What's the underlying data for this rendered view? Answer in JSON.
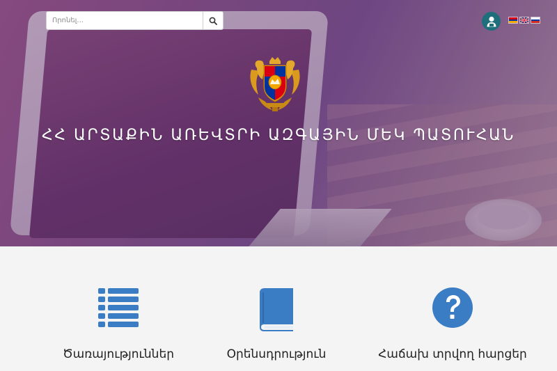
{
  "search": {
    "placeholder": "Որոնել..."
  },
  "header": {
    "user_icon": "user-icon",
    "languages": [
      {
        "code": "am",
        "colors": [
          "#d90012",
          "#0033a0",
          "#f2a800"
        ]
      },
      {
        "code": "en",
        "icon": "uk-flag-icon"
      },
      {
        "code": "ru",
        "colors": [
          "#ffffff",
          "#0039a6",
          "#d52b1e"
        ]
      }
    ]
  },
  "hero": {
    "emblem_icon": "coat-of-arms-icon",
    "title": "ՀՀ ԱՐՏԱՔԻՆ ԱՌԵՎՏՐԻ ԱԶԳԱՅԻՆ ՄԵԿ ՊԱՏՈՒՀԱՆ"
  },
  "features": [
    {
      "icon": "list-icon",
      "label": "Ծառայություններ"
    },
    {
      "icon": "book-icon",
      "label": "Օրենսդրություն"
    },
    {
      "icon": "question-circle-icon",
      "label": "Հաճախ տրվող հարցեր"
    }
  ],
  "colors": {
    "accent_blue": "#3b7dc4",
    "avatar_bg": "#1f6e7c"
  }
}
